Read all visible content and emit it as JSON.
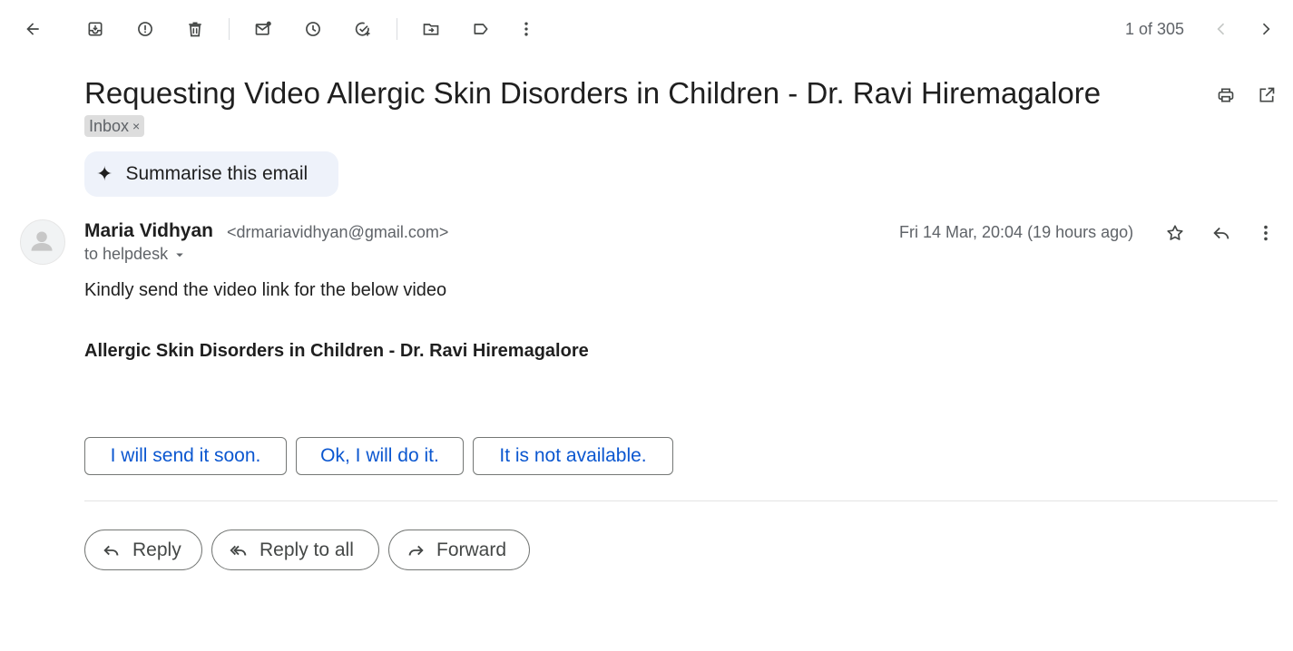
{
  "toolbar": {
    "icons": [
      "back-arrow-icon",
      "archive-icon",
      "report-spam-icon",
      "delete-icon",
      "mark-unread-icon",
      "snooze-icon",
      "add-to-tasks-icon",
      "move-to-icon",
      "label-icon",
      "more-vert-icon"
    ],
    "pager": "1 of 305"
  },
  "email": {
    "subject": "Requesting Video Allergic Skin Disorders in Children - Dr. Ravi Hiremagalore",
    "label": "Inbox",
    "label_close": "×",
    "summarise": "Summarise this email",
    "sender_name": "Maria Vidhyan",
    "sender_email": "<drmariavidhyan@gmail.com>",
    "to": "to helpdesk",
    "date": "Fri 14 Mar, 20:04 (19 hours ago)",
    "body_line1": "Kindly send the video link for the below video",
    "body_line2": "Allergic Skin Disorders in Children - Dr. Ravi Hiremagalore"
  },
  "smart_replies": [
    "I will send it soon.",
    "Ok, I will do it.",
    "It is not available."
  ],
  "actions": {
    "reply": "Reply",
    "reply_all": "Reply to all",
    "forward": "Forward"
  },
  "colors": {
    "accent": "#0b57d0",
    "summarise_bg": "#eef2fa",
    "chip_bg": "#dddddd"
  }
}
